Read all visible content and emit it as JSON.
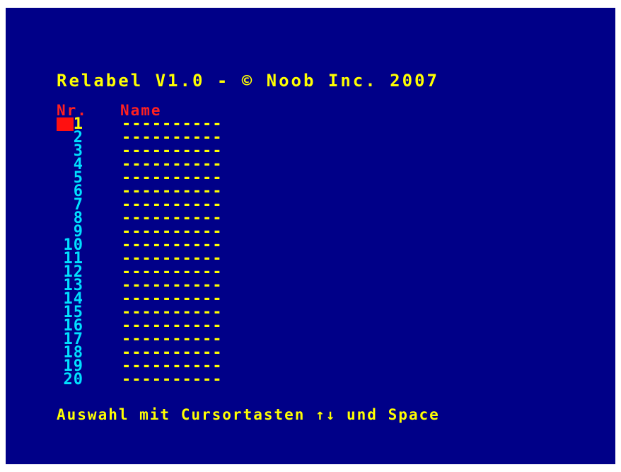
{
  "title": "Relabel V1.0 - © Noob Inc. 2007",
  "columns": {
    "nr": "Nr.",
    "name": "Name"
  },
  "selected_row": 1,
  "rows": [
    {
      "nr": "1",
      "name": "----------"
    },
    {
      "nr": "2",
      "name": "----------"
    },
    {
      "nr": "3",
      "name": "----------"
    },
    {
      "nr": "4",
      "name": "----------"
    },
    {
      "nr": "5",
      "name": "----------"
    },
    {
      "nr": "6",
      "name": "----------"
    },
    {
      "nr": "7",
      "name": "----------"
    },
    {
      "nr": "8",
      "name": "----------"
    },
    {
      "nr": "9",
      "name": "----------"
    },
    {
      "nr": "10",
      "name": "----------"
    },
    {
      "nr": "11",
      "name": "----------"
    },
    {
      "nr": "12",
      "name": "----------"
    },
    {
      "nr": "13",
      "name": "----------"
    },
    {
      "nr": "14",
      "name": "----------"
    },
    {
      "nr": "15",
      "name": "----------"
    },
    {
      "nr": "16",
      "name": "----------"
    },
    {
      "nr": "17",
      "name": "----------"
    },
    {
      "nr": "18",
      "name": "----------"
    },
    {
      "nr": "19",
      "name": "----------"
    },
    {
      "nr": "20",
      "name": "----------"
    }
  ],
  "footer": "Auswahl mit Cursortasten ↑↓ und Space",
  "colors": {
    "background": "#000088",
    "title": "#ffff00",
    "header": "#ff2020",
    "number": "#00e0ff",
    "cursor": "#ff1010",
    "name": "#ffff00"
  }
}
